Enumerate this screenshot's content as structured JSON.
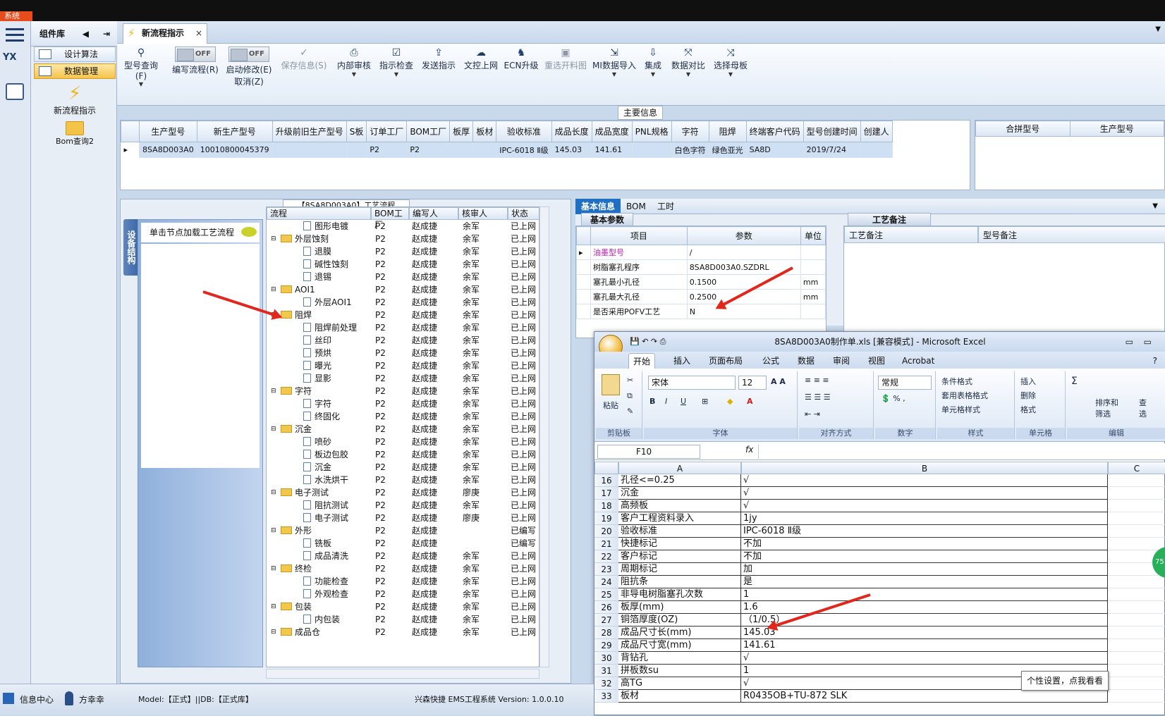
{
  "os": {
    "system_label": "系统"
  },
  "sidebar": {
    "header": "组件库",
    "items": [
      {
        "label": "设计算法"
      },
      {
        "label": "数据管理"
      }
    ],
    "big_items": [
      {
        "label": "新流程指示"
      },
      {
        "label": "Bom查询2"
      }
    ],
    "logo_text": "YX"
  },
  "tabs": {
    "active": "新流程指示",
    "close": "×"
  },
  "toolbar": {
    "items": [
      {
        "label": "型号查询(F)",
        "icon": "search-icon"
      },
      {
        "label": "编写流程(R)",
        "toggle": "OFF"
      },
      {
        "label": "启动修改(E)",
        "label2": "取消(Z)",
        "toggle": "OFF"
      },
      {
        "label": "保存信息(S)",
        "icon": "check-icon",
        "disabled": true
      },
      {
        "label": "内部审核",
        "icon": "printer-icon"
      },
      {
        "label": "指示检查",
        "icon": "checkbox-icon"
      },
      {
        "label": "发送指示",
        "icon": "upload-icon"
      },
      {
        "label": "文控上网",
        "icon": "cloud-upload-icon"
      },
      {
        "label": "ECN升级",
        "icon": "people-icon"
      },
      {
        "label": "重选开料图",
        "icon": "image-icon",
        "disabled": true
      },
      {
        "label": "MI数据导入",
        "icon": "import-icon"
      },
      {
        "label": "集成",
        "icon": "download-icon"
      },
      {
        "label": "数据对比",
        "icon": "compare-icon"
      },
      {
        "label": "选择母板",
        "icon": "shuffle-icon"
      }
    ]
  },
  "main_info": {
    "title": "主要信息",
    "columns": [
      "生产型号",
      "新生产型号",
      "升级前旧生产型号",
      "S板",
      "订单工厂",
      "BOM工厂",
      "板厚",
      "板材",
      "验收标准",
      "成品长度",
      "成品宽度",
      "PNL规格",
      "字符",
      "阻焊",
      "终端客户代码",
      "型号创建时间",
      "创建人"
    ],
    "row": [
      "8SA8D003A0",
      "10010800045379",
      "",
      "",
      "P2",
      "P2",
      "",
      "",
      "IPC-6018 Ⅱ级",
      "145.03",
      "141.61",
      "",
      "白色字符",
      "绿色亚光",
      "SA8D",
      "2019/7/24",
      ""
    ],
    "side_columns": [
      "合拼型号",
      "生产型号"
    ]
  },
  "process": {
    "title": "【8SA8D003A0】工艺流程",
    "vertical_tab": "设备结构",
    "load_hint": "单击节点加载工艺流程",
    "columns": [
      "流程",
      "BOM工厂",
      "编写人",
      "核审人",
      "状态"
    ],
    "rows": [
      {
        "level": 2,
        "name": "图形电镀",
        "f": "P2",
        "w": "赵成捷",
        "r": "余军",
        "s": "已上网"
      },
      {
        "level": 1,
        "name": "外层蚀刻",
        "f": "P2",
        "w": "赵成捷",
        "r": "余军",
        "s": "已上网"
      },
      {
        "level": 2,
        "name": "退膜",
        "f": "P2",
        "w": "赵成捷",
        "r": "余军",
        "s": "已上网"
      },
      {
        "level": 2,
        "name": "碱性蚀刻",
        "f": "P2",
        "w": "赵成捷",
        "r": "余军",
        "s": "已上网"
      },
      {
        "level": 2,
        "name": "退锡",
        "f": "P2",
        "w": "赵成捷",
        "r": "余军",
        "s": "已上网"
      },
      {
        "level": 1,
        "name": "AOI1",
        "f": "P2",
        "w": "赵成捷",
        "r": "余军",
        "s": "已上网"
      },
      {
        "level": 2,
        "name": "外层AOI1",
        "f": "P2",
        "w": "赵成捷",
        "r": "余军",
        "s": "已上网"
      },
      {
        "level": 1,
        "name": "阻焊",
        "f": "P2",
        "w": "赵成捷",
        "r": "余军",
        "s": "已上网"
      },
      {
        "level": 2,
        "name": "阻焊前处理",
        "f": "P2",
        "w": "赵成捷",
        "r": "余军",
        "s": "已上网"
      },
      {
        "level": 2,
        "name": "丝印",
        "f": "P2",
        "w": "赵成捷",
        "r": "余军",
        "s": "已上网"
      },
      {
        "level": 2,
        "name": "预烘",
        "f": "P2",
        "w": "赵成捷",
        "r": "余军",
        "s": "已上网"
      },
      {
        "level": 2,
        "name": "曝光",
        "f": "P2",
        "w": "赵成捷",
        "r": "余军",
        "s": "已上网"
      },
      {
        "level": 2,
        "name": "显影",
        "f": "P2",
        "w": "赵成捷",
        "r": "余军",
        "s": "已上网"
      },
      {
        "level": 1,
        "name": "字符",
        "f": "P2",
        "w": "赵成捷",
        "r": "余军",
        "s": "已上网"
      },
      {
        "level": 2,
        "name": "字符",
        "f": "P2",
        "w": "赵成捷",
        "r": "余军",
        "s": "已上网"
      },
      {
        "level": 2,
        "name": "终固化",
        "f": "P2",
        "w": "赵成捷",
        "r": "余军",
        "s": "已上网"
      },
      {
        "level": 1,
        "name": "沉金",
        "f": "P2",
        "w": "赵成捷",
        "r": "余军",
        "s": "已上网"
      },
      {
        "level": 2,
        "name": "喷砂",
        "f": "P2",
        "w": "赵成捷",
        "r": "余军",
        "s": "已上网"
      },
      {
        "level": 2,
        "name": "板边包胶",
        "f": "P2",
        "w": "赵成捷",
        "r": "余军",
        "s": "已上网"
      },
      {
        "level": 2,
        "name": "沉金",
        "f": "P2",
        "w": "赵成捷",
        "r": "余军",
        "s": "已上网"
      },
      {
        "level": 2,
        "name": "水洗烘干",
        "f": "P2",
        "w": "赵成捷",
        "r": "余军",
        "s": "已上网"
      },
      {
        "level": 1,
        "name": "电子测试",
        "f": "P2",
        "w": "赵成捷",
        "r": "廖庚",
        "s": "已上网"
      },
      {
        "level": 2,
        "name": "阻抗测试",
        "f": "P2",
        "w": "赵成捷",
        "r": "余军",
        "s": "已上网"
      },
      {
        "level": 2,
        "name": "电子测试",
        "f": "P2",
        "w": "赵成捷",
        "r": "廖庚",
        "s": "已上网"
      },
      {
        "level": 1,
        "name": "外形",
        "f": "P2",
        "w": "赵成捷",
        "r": "",
        "s": "已编写"
      },
      {
        "level": 2,
        "name": "铣板",
        "f": "P2",
        "w": "赵成捷",
        "r": "",
        "s": "已编写"
      },
      {
        "level": 2,
        "name": "成品清洗",
        "f": "P2",
        "w": "赵成捷",
        "r": "余军",
        "s": "已上网"
      },
      {
        "level": 1,
        "name": "终检",
        "f": "P2",
        "w": "赵成捷",
        "r": "余军",
        "s": "已上网"
      },
      {
        "level": 2,
        "name": "功能检查",
        "f": "P2",
        "w": "赵成捷",
        "r": "余军",
        "s": "已上网"
      },
      {
        "level": 2,
        "name": "外观检查",
        "f": "P2",
        "w": "赵成捷",
        "r": "余军",
        "s": "已上网"
      },
      {
        "level": 1,
        "name": "包装",
        "f": "P2",
        "w": "赵成捷",
        "r": "余军",
        "s": "已上网"
      },
      {
        "level": 2,
        "name": "内包装",
        "f": "P2",
        "w": "赵成捷",
        "r": "余军",
        "s": "已上网"
      },
      {
        "level": 1,
        "name": "成品仓",
        "f": "P2",
        "w": "赵成捷",
        "r": "余军",
        "s": "已上网"
      }
    ]
  },
  "basic": {
    "tabs": [
      "基本信息",
      "BOM",
      "工时"
    ],
    "group": "基本参数",
    "columns": [
      "项目",
      "参数",
      "单位"
    ],
    "rows": [
      {
        "item": "油墨型号",
        "param": "/",
        "unit": ""
      },
      {
        "item": "树脂塞孔程序",
        "param": "8SA8D003A0.SZDRL",
        "unit": ""
      },
      {
        "item": "塞孔最小孔径",
        "param": "0.1500",
        "unit": "mm"
      },
      {
        "item": "塞孔最大孔径",
        "param": "0.2500",
        "unit": "mm"
      },
      {
        "item": "是否采用POFV工艺",
        "param": "N",
        "unit": ""
      }
    ],
    "craft_group": "工艺备注",
    "craft_columns": [
      "工艺备注",
      "型号备注"
    ]
  },
  "excel": {
    "title": "8SA8D003A0制作单.xls [兼容模式] - Microsoft Excel",
    "tabs": [
      "开始",
      "插入",
      "页面布局",
      "公式",
      "数据",
      "审阅",
      "视图",
      "Acrobat"
    ],
    "ribbon": {
      "paste": "粘贴",
      "clipboard": "剪贴板",
      "font_name": "宋体",
      "font_size": "12",
      "font_group": "字体",
      "align_group": "对齐方式",
      "number_format": "常规",
      "number_group": "数字",
      "cond_format": "条件格式",
      "table_format": "套用表格格式",
      "cell_style": "单元格样式",
      "style_group": "样式",
      "insert": "插入",
      "delete": "删除",
      "format": "格式",
      "cells_group": "单元格",
      "sort": "排序和",
      "filter": "筛选",
      "find": "查",
      "select": "选",
      "edit_group": "编辑"
    },
    "name_box": "F10",
    "fx": "fx",
    "columns": [
      "A",
      "B",
      "C"
    ],
    "rows": [
      {
        "n": "16",
        "a": "孔径<=0.25",
        "b": "√"
      },
      {
        "n": "17",
        "a": "沉金",
        "b": "√"
      },
      {
        "n": "18",
        "a": "高频板",
        "b": "√"
      },
      {
        "n": "19",
        "a": "客户工程资料录入",
        "b": "1jy"
      },
      {
        "n": "20",
        "a": "验收标准",
        "b": "IPC-6018 Ⅱ级"
      },
      {
        "n": "21",
        "a": "快捷标记",
        "b": "不加"
      },
      {
        "n": "22",
        "a": "客户标记",
        "b": "不加"
      },
      {
        "n": "23",
        "a": "周期标记",
        "b": "加"
      },
      {
        "n": "24",
        "a": "阻抗条",
        "b": "是"
      },
      {
        "n": "25",
        "a": "非导电树脂塞孔次数",
        "b": "1"
      },
      {
        "n": "26",
        "a": "板厚(mm)",
        "b": "1.6"
      },
      {
        "n": "27",
        "a": "铜箔厚度(OZ)",
        "b": "（1/0.5）"
      },
      {
        "n": "28",
        "a": "成品尺寸长(mm)",
        "b": "145.03"
      },
      {
        "n": "29",
        "a": "成品尺寸宽(mm)",
        "b": "141.61"
      },
      {
        "n": "30",
        "a": "背钻孔",
        "b": "√"
      },
      {
        "n": "31",
        "a": "拼板数su",
        "b": "1"
      },
      {
        "n": "32",
        "a": "高TG",
        "b": "√"
      },
      {
        "n": "33",
        "a": "板材",
        "b": "R0435OB+TU-872 SLK"
      }
    ]
  },
  "status": {
    "info_center": "信息中心",
    "user": "方幸幸",
    "model": "Model:【正式】||DB:【正式库】",
    "app": "兴森快捷 EMS工程系统 Version: 1.0.0.10"
  },
  "tooltip": "个性设置，点我看看",
  "badge": "75",
  "colors": {
    "accent": "#1f6fc2",
    "selected_row": "#cfe0f5",
    "arrow": "#e3261c",
    "menu_active": "#f6c44a"
  }
}
